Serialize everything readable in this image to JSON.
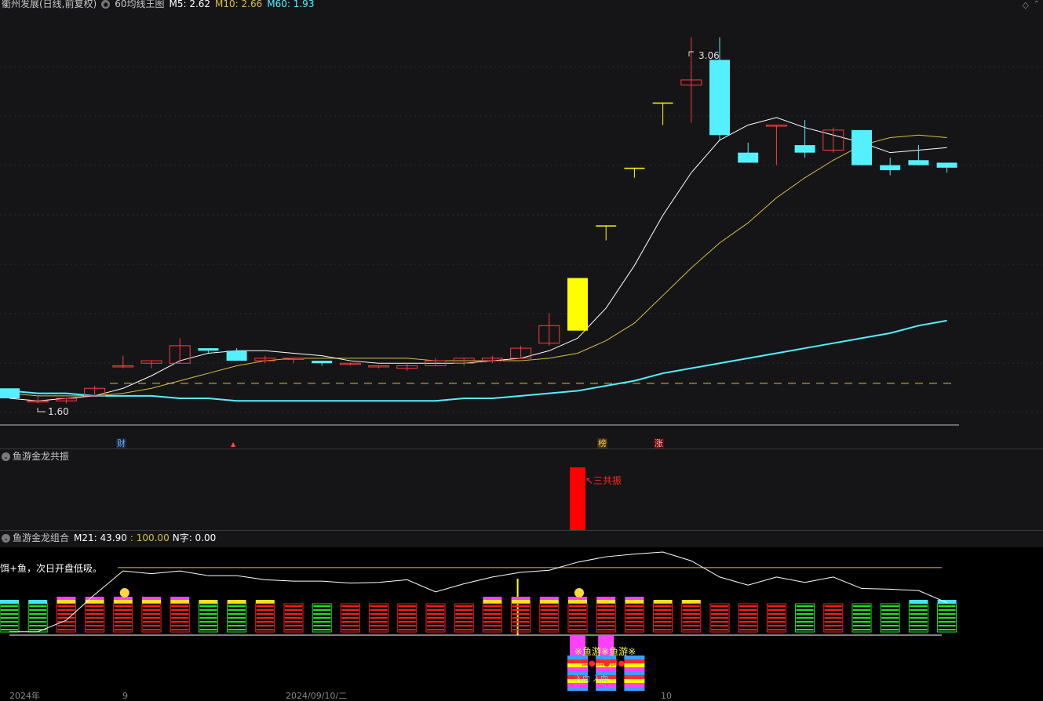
{
  "main": {
    "stock_title": "衢州发展(日线,前复权)",
    "indicator_name": "60均线王图",
    "ma5_label": "M5: 2.62",
    "ma10_label": "M10: 2.66",
    "ma60_label": "M60: 1.93",
    "high_label": "3.06",
    "low_label": "1.60",
    "badge_cai": "财",
    "badge_bang": "榜",
    "badge_zhang": "涨",
    "colors": {
      "up": "#ff3b3b",
      "down": "#54f0ff",
      "ma5": "#ffffff",
      "ma10": "#d6c044",
      "ma60": "#54f0ff",
      "limit_up": "#ffff00"
    }
  },
  "osc1": {
    "title": "鱼游金龙共振",
    "signal_label": "↖三共振"
  },
  "osc2": {
    "title": "鱼游金龙组合",
    "m21_label": "M21: 43.90",
    "sep_label": ": 100.00",
    "nzi_label": "N字: 0.00",
    "note": "饵+鱼，次日开盘低吸。",
    "fish_label": "※鱼游※鱼游※",
    "bait_label": "饵●饵●饵●",
    "ru_label": "入向 入向"
  },
  "bottom_axis": {
    "year_label": "2024年",
    "tick_a": "9",
    "date_label": "2024/09/10/二",
    "tick_b": "10"
  },
  "chart_data": {
    "type": "candlestick",
    "series": [
      {
        "name": "K",
        "candles": [
          {
            "o": 1.66,
            "h": 1.66,
            "l": 1.62,
            "c": 1.62
          },
          {
            "o": 1.61,
            "h": 1.63,
            "l": 1.6,
            "c": 1.61
          },
          {
            "o": 1.61,
            "h": 1.62,
            "l": 1.6,
            "c": 1.62
          },
          {
            "o": 1.63,
            "h": 1.67,
            "l": 1.63,
            "c": 1.66
          },
          {
            "o": 1.75,
            "h": 1.79,
            "l": 1.74,
            "c": 1.75
          },
          {
            "o": 1.76,
            "h": 1.77,
            "l": 1.74,
            "c": 1.77
          },
          {
            "o": 1.76,
            "h": 1.86,
            "l": 1.76,
            "c": 1.83
          },
          {
            "o": 1.82,
            "h": 1.81,
            "l": 1.8,
            "c": 1.81
          },
          {
            "o": 1.81,
            "h": 1.82,
            "l": 1.77,
            "c": 1.77
          },
          {
            "o": 1.77,
            "h": 1.79,
            "l": 1.76,
            "c": 1.78
          },
          {
            "o": 1.78,
            "h": 1.78,
            "l": 1.76,
            "c": 1.78
          },
          {
            "o": 1.77,
            "h": 1.77,
            "l": 1.75,
            "c": 1.76
          },
          {
            "o": 1.76,
            "h": 1.76,
            "l": 1.75,
            "c": 1.76
          },
          {
            "o": 1.75,
            "h": 1.75,
            "l": 1.74,
            "c": 1.75
          },
          {
            "o": 1.74,
            "h": 1.76,
            "l": 1.73,
            "c": 1.75
          },
          {
            "o": 1.75,
            "h": 1.78,
            "l": 1.75,
            "c": 1.77
          },
          {
            "o": 1.76,
            "h": 1.78,
            "l": 1.75,
            "c": 1.78
          },
          {
            "o": 1.77,
            "h": 1.79,
            "l": 1.76,
            "c": 1.78
          },
          {
            "o": 1.78,
            "h": 1.83,
            "l": 1.78,
            "c": 1.82
          },
          {
            "o": 1.84,
            "h": 1.96,
            "l": 1.83,
            "c": 1.91
          },
          {
            "o": 1.89,
            "h": 2.1,
            "l": 1.89,
            "c": 2.1
          },
          {
            "o": 2.31,
            "h": 2.31,
            "l": 2.25,
            "c": 2.31
          },
          {
            "o": 2.54,
            "h": 2.54,
            "l": 2.5,
            "c": 2.54
          },
          {
            "o": 2.8,
            "h": 2.8,
            "l": 2.71,
            "c": 2.8
          },
          {
            "o": 2.87,
            "h": 3.06,
            "l": 2.72,
            "c": 2.89
          },
          {
            "o": 2.97,
            "h": 3.06,
            "l": 2.65,
            "c": 2.67
          },
          {
            "o": 2.6,
            "h": 2.64,
            "l": 2.56,
            "c": 2.56
          },
          {
            "o": 2.71,
            "h": 2.71,
            "l": 2.55,
            "c": 2.71
          },
          {
            "o": 2.63,
            "h": 2.73,
            "l": 2.58,
            "c": 2.6
          },
          {
            "o": 2.61,
            "h": 2.7,
            "l": 2.6,
            "c": 2.69
          },
          {
            "o": 2.69,
            "h": 2.68,
            "l": 2.55,
            "c": 2.55
          },
          {
            "o": 2.55,
            "h": 2.58,
            "l": 2.51,
            "c": 2.53
          },
          {
            "o": 2.57,
            "h": 2.63,
            "l": 2.55,
            "c": 2.55
          },
          {
            "o": 2.56,
            "h": 2.55,
            "l": 2.52,
            "c": 2.54
          }
        ]
      },
      {
        "name": "M5",
        "values": [
          1.62,
          1.61,
          1.62,
          1.63,
          1.66,
          1.71,
          1.77,
          1.8,
          1.81,
          1.81,
          1.8,
          1.79,
          1.77,
          1.76,
          1.76,
          1.76,
          1.76,
          1.77,
          1.78,
          1.81,
          1.86,
          1.98,
          2.15,
          2.35,
          2.52,
          2.65,
          2.71,
          2.74,
          2.7,
          2.67,
          2.64,
          2.6,
          2.61,
          2.62
        ]
      },
      {
        "name": "M10",
        "values": [
          1.64,
          1.63,
          1.63,
          1.63,
          1.64,
          1.66,
          1.69,
          1.72,
          1.75,
          1.77,
          1.78,
          1.78,
          1.78,
          1.78,
          1.78,
          1.77,
          1.77,
          1.77,
          1.77,
          1.78,
          1.8,
          1.85,
          1.92,
          2.03,
          2.14,
          2.24,
          2.32,
          2.42,
          2.5,
          2.57,
          2.63,
          2.66,
          2.67,
          2.66
        ]
      },
      {
        "name": "M60",
        "values": [
          1.65,
          1.64,
          1.64,
          1.63,
          1.63,
          1.63,
          1.62,
          1.62,
          1.61,
          1.61,
          1.61,
          1.61,
          1.61,
          1.61,
          1.61,
          1.61,
          1.62,
          1.62,
          1.63,
          1.64,
          1.65,
          1.67,
          1.69,
          1.72,
          1.74,
          1.76,
          1.78,
          1.8,
          1.82,
          1.84,
          1.86,
          1.88,
          1.91,
          1.93
        ]
      }
    ],
    "ylim": [
      1.52,
      3.14
    ],
    "y_hline": 1.68,
    "osc1_bars": [
      {
        "index": 20,
        "value": 1
      }
    ],
    "osc2_line": [
      5,
      5,
      22,
      60,
      95,
      91,
      95,
      88,
      88,
      82,
      80,
      80,
      77,
      78,
      82,
      64,
      76,
      86,
      93,
      96,
      108,
      116,
      120,
      123,
      110,
      86,
      74,
      86,
      78,
      86,
      69,
      68,
      66,
      48
    ],
    "osc2_ylim": [
      0,
      130
    ],
    "osc2_hline": 100,
    "grid": true
  }
}
